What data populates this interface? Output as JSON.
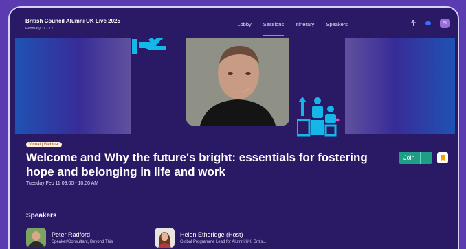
{
  "app": {
    "title": "British Council Alumni UK Live 2025",
    "dates": "February 11 - 12"
  },
  "nav": {
    "tabs": [
      {
        "label": "Lobby",
        "active": false
      },
      {
        "label": "Sessions",
        "active": true
      },
      {
        "label": "Itinerary",
        "active": false
      },
      {
        "label": "Speakers",
        "active": false
      }
    ],
    "avatar_initials": "AI"
  },
  "session": {
    "badge": "Virtual | Webinar",
    "title": "Welcome and Why the future's bright: essentials for fostering hope and belonging in life and work",
    "datetime": "Tuesday Feb 11 09:00 - 10:00 AM",
    "join_label": "Join",
    "more_label": "···"
  },
  "speakers": {
    "heading": "Speakers",
    "items": [
      {
        "name": "Peter Radford",
        "role": "Speaker/Consultant, Beyond This"
      },
      {
        "name": "Helen Etheridge (Host)",
        "role": "Global Programme Lead for Alumni UK, Britis..."
      }
    ]
  },
  "colors": {
    "background": "#2a1a66",
    "accent_teal": "#1f9e86",
    "hero_icon_cyan": "#14b7e8",
    "badge_bg": "#fdf2df"
  }
}
